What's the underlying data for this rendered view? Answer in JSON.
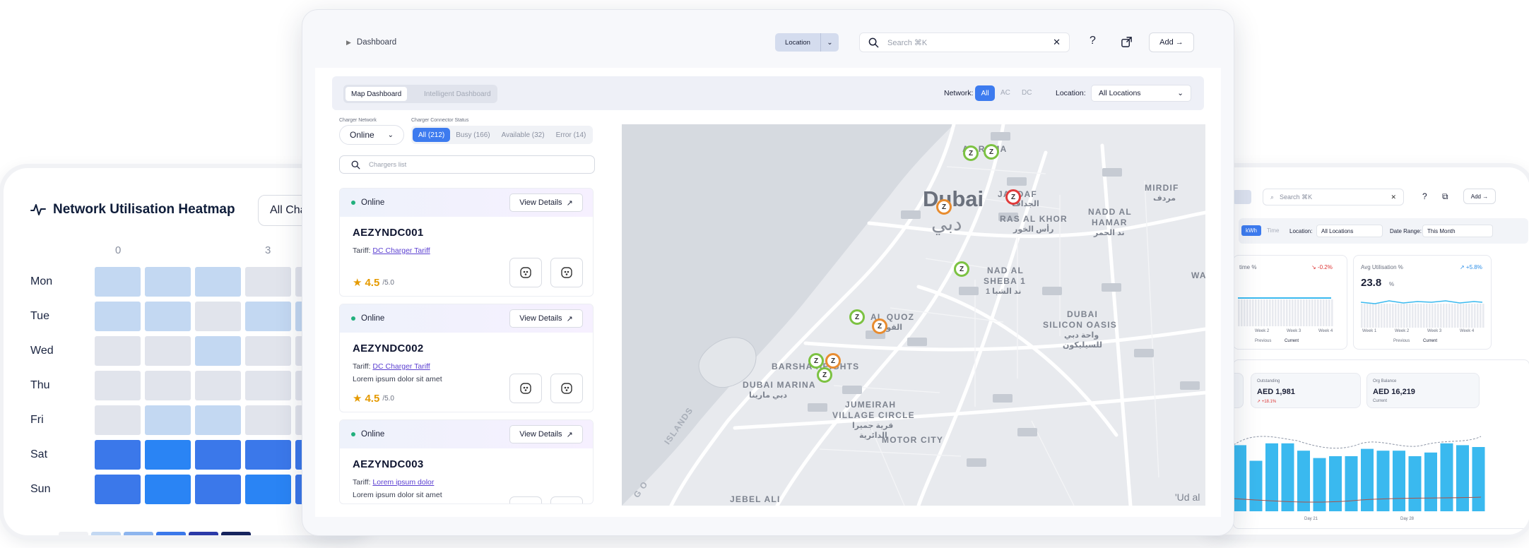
{
  "heatmap": {
    "title": "Network Utilisation Heatmap",
    "filter": "All Cha",
    "hours": [
      "0",
      "3"
    ],
    "days": [
      "Mon",
      "Tue",
      "Wed",
      "Thu",
      "Fri",
      "Sat",
      "Sun"
    ]
  },
  "main": {
    "breadcrumb": "Dashboard",
    "location_btn": "Location",
    "search_placeholder": "Search ⌘K",
    "add_btn": "Add →",
    "tabs": [
      "Map Dashboard",
      "Intelligent Dashboard"
    ],
    "network_label": "Network:",
    "network_options": [
      "All",
      "AC",
      "DC"
    ],
    "location_label": "Location:",
    "location_value": "All Locations",
    "charger_network_label": "Charger Network",
    "charger_network_value": "Online",
    "connector_status_label": "Charger Connector Status",
    "status_chips": [
      "All (212)",
      "Busy (166)",
      "Available (32)",
      "Error (14)"
    ],
    "chargers_placeholder": "Chargers list",
    "chargers": [
      {
        "status": "Online",
        "view": "View Details",
        "id": "AEZYNDC001",
        "tariff_label": "Tariff:",
        "tariff": "DC Charger Tariff",
        "desc": "",
        "rating": "4.5",
        "rating_max": "/5.0"
      },
      {
        "status": "Online",
        "view": "View Details",
        "id": "AEZYNDC002",
        "tariff_label": "Tariff:",
        "tariff": "DC Charger Tariff",
        "desc": "Lorem ipsum dolor sit amet",
        "rating": "4.5",
        "rating_max": "/5.0"
      },
      {
        "status": "Online",
        "view": "View Details",
        "id": "AEZYNDC003",
        "tariff_label": "Tariff:",
        "tariff": "Lorem ipsum dolor",
        "desc": "Lorem ipsum dolor sit amet",
        "rating": "",
        "rating_max": ""
      }
    ],
    "map_labels": {
      "dubai": "Dubai",
      "dubai_ar": "دبي",
      "rama": "AL RAMA",
      "jaddaf": "JADDAF",
      "jaddaf_ar": "الجداف",
      "mirdif": "MIRDIF",
      "mirdif_ar": "مردف",
      "ras": "RAS AL KHOR",
      "ras_ar": "رأس الخور",
      "nadd1": "NADD AL",
      "nadd2": "HAMAR",
      "nadd_ar": "ند الحمر",
      "sheba1": "NAD AL",
      "sheba2": "SHEBA 1",
      "sheba_ar": "ند الشبا 1",
      "quoz": "AL QUOZ",
      "quoz_ar": "القوز",
      "silicon1": "DUBAI",
      "silicon2": "SILICON OASIS",
      "silicon_ar1": "واحة دبي",
      "silicon_ar2": "للسيليكون",
      "barsha": "BARSHA HEIGHTS",
      "marina": "DUBAI MARINA",
      "marina_ar": "دبي مارينا",
      "jvc1": "JUMEIRAH",
      "jvc2": "VILLAGE CIRCLE",
      "jvc_ar1": "قرية جميرا",
      "jvc_ar2": "الدائرية",
      "motor": "MOTOR CITY",
      "jebel": "JEBEL ALI",
      "islands": "ISLANDS",
      "islands2": "G O",
      "wa": "WA",
      "uddal": "'Ud al"
    }
  },
  "right_card": {
    "search_placeholder": "Search ⌘K",
    "add_btn": "Add →",
    "toggle": [
      "kWh",
      "Time"
    ],
    "location_label": "Location:",
    "location_value": "All Locations",
    "date_label": "Date Range:",
    "date_value": "This Month",
    "uptime_title": "time %",
    "uptime_delta": "↘ -0.2%",
    "util_title": "Avg Utilisation %",
    "util_delta": "↗ +5.8%",
    "util_value": "23.8",
    "util_unit": "%",
    "weeks": [
      "Week 2",
      "Week 3",
      "Week 4"
    ],
    "weeks2": [
      "Week 1",
      "Week 2",
      "Week 3",
      "Week 4"
    ],
    "legend_prev": "Previous",
    "legend_curr": "Current",
    "outstanding_label": "Outstanding",
    "outstanding_value": "AED 1,981",
    "outstanding_delta": "↗ +18.1%",
    "balance_label": "Org Balance",
    "balance_value": "AED 16,219",
    "balance_sub": "Current",
    "x_day21": "Day 21",
    "x_day28": "Day 28",
    "bars": [
      0.72,
      0.55,
      0.74,
      0.74,
      0.66,
      0.58,
      0.6,
      0.6,
      0.68,
      0.66,
      0.66,
      0.6,
      0.64,
      0.74,
      0.72,
      0.7
    ]
  },
  "colors": {
    "accent": "#3d7bef",
    "heat_light": "#c3d8f2",
    "heat_grey": "#e1e4ec",
    "heat_strong": "#3b78ea",
    "heat_strong2": "#2a84f4",
    "bar": "#3ab9ef"
  }
}
